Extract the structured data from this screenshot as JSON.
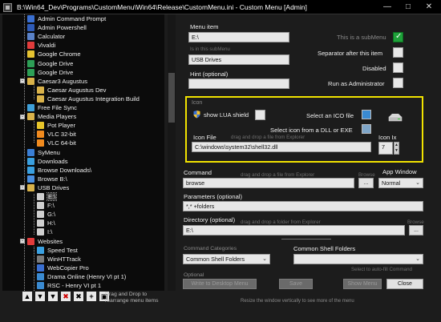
{
  "window": {
    "title": "B:\\Win64_Dev\\Programs\\CustomMenu\\Win64\\Release\\CustomMenu.ini - Custom Menu [Admin]",
    "minimize": "—",
    "maximize": "□",
    "close": "✕"
  },
  "tree": {
    "items": [
      {
        "label": "Admin Command Prompt",
        "icon_color": "#3a6fd1"
      },
      {
        "label": "Admin Powershell",
        "icon_color": "#2e5bb8"
      },
      {
        "label": "Calculator",
        "icon_color": "#5a82c8"
      },
      {
        "label": "Vivaldi",
        "icon_color": "#e23c3c"
      },
      {
        "label": "Google Chrome",
        "icon_color": "#e5c331"
      },
      {
        "label": "Google Drive",
        "icon_color": "#2d9f56"
      },
      {
        "label": "Google Drive",
        "icon_color": "#2d9f56"
      },
      {
        "label": "Caesar3 Augustus",
        "icon_color": "#d9b24a"
      },
      {
        "label": "Caesar Augustus Dev",
        "icon_color": "#d9b24a"
      },
      {
        "label": "Caesar Augustus Integration Build",
        "icon_color": "#d9b24a"
      },
      {
        "label": "Free File Sync",
        "icon_color": "#3fa0d9"
      },
      {
        "label": "Media Players",
        "icon_color": "#d9b24a"
      },
      {
        "label": "Pot Player",
        "icon_color": "#e8c52a"
      },
      {
        "label": "VLC 32-bit",
        "icon_color": "#f08a1e"
      },
      {
        "label": "VLC 64-bit",
        "icon_color": "#f08a1e"
      },
      {
        "label": "SyMenu",
        "icon_color": "#3a7fd6"
      },
      {
        "label": "Downloads",
        "icon_color": "#3aa0e0"
      },
      {
        "label": "Browse Downloads\\",
        "icon_color": "#3aa0e0"
      },
      {
        "label": "Browse B:\\",
        "icon_color": "#4a8fe0"
      },
      {
        "label": "USB Drives",
        "icon_color": "#d9b24a"
      },
      {
        "label": "E:\\",
        "icon_color": "#cfcfcf"
      },
      {
        "label": "F:\\",
        "icon_color": "#cfcfcf"
      },
      {
        "label": "G:\\",
        "icon_color": "#cfcfcf"
      },
      {
        "label": "H:\\",
        "icon_color": "#cfcfcf"
      },
      {
        "label": "I:\\",
        "icon_color": "#cfcfcf"
      },
      {
        "label": "Websites",
        "icon_color": "#e23c3c"
      },
      {
        "label": "Speed Test",
        "icon_color": "#3aa0e0"
      },
      {
        "label": "WinHTTrack",
        "icon_color": "#7a7a7a"
      },
      {
        "label": "WebCopier Pro",
        "icon_color": "#3a6fd1"
      },
      {
        "label": "Drama Online (Henry VI pt 1)",
        "icon_color": "#3a8ad1"
      },
      {
        "label": "RSC - Henry VI pt 1",
        "icon_color": "#3a8ad1"
      }
    ],
    "toolbar": [
      "▲",
      "▼",
      "▼",
      "✖",
      "✖",
      "+",
      "▣"
    ],
    "drag_hint": "Drag and Drop to rearrange menu items"
  },
  "form": {
    "menu_item_label": "Menu item",
    "menu_item_value": "E:\\",
    "submenu_hint": "Is in this subMenu",
    "submenu_value": "USB Drives",
    "hint_label": "Hint (optional)",
    "hint_value": "",
    "is_submenu_label": "This is a subMenu",
    "is_submenu_checked": true,
    "separator_label": "Separator after this item",
    "disabled_label": "Disabled",
    "run_admin_label": "Run as Administrator",
    "icon_section_label": "Icon",
    "show_lua_label": "show LUA shield",
    "select_ico_label": "Select an ICO file",
    "select_dll_label": "Select icon from a DLL or EXE",
    "icon_file_label": "Icon File",
    "icon_file_hint": "drag and drop a file from Explorer",
    "icon_file_value": "C:\\windows\\system32\\shell32.dll",
    "icon_index_label": "Icon Ix",
    "icon_index_value": "7",
    "command_label": "Command",
    "command_hint": "drag and drop a file from Explorer",
    "command_value": "browse",
    "browse_label": "Browse",
    "ellipsis": "...",
    "app_window_label": "App Window",
    "app_window_value": "Normal",
    "parameters_label": "Parameters (optional)",
    "parameters_value": "*,* +folders",
    "directory_label": "Directory (optional)",
    "directory_hint": "drag and drop a folder from Explorer",
    "directory_value": "E:\\",
    "command_categories_label": "Command Categories",
    "command_categories_value": "Common Shell Folders",
    "common_shell_folders_label": "Common Shell Folders",
    "common_shell_folders_value": "",
    "autofill_hint": "Select to auto-fill Command",
    "optional_label": "Optional",
    "write_desktop_label": "Write to Desktop Menu",
    "save_label": "Save",
    "show_menu_label": "Show Menu",
    "close_label": "Close",
    "resize_hint": "Resize the window vertically to see more of the menu"
  }
}
